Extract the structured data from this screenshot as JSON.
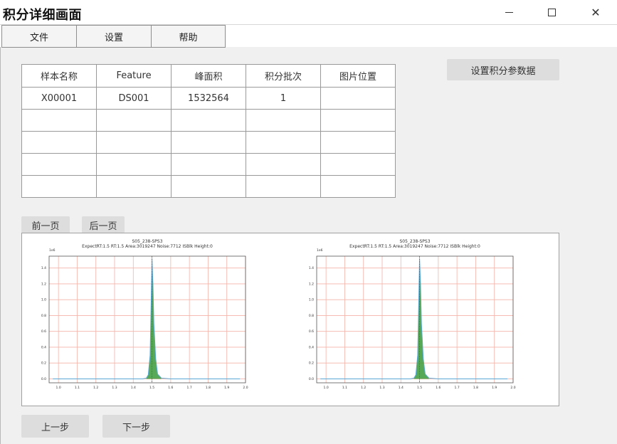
{
  "window": {
    "title": "积分详细画面",
    "controls": {
      "minimize": "minimize",
      "maximize": "maximize",
      "close": "✕"
    }
  },
  "menu": {
    "items": [
      "文件",
      "设置",
      "帮助"
    ]
  },
  "table": {
    "headers": [
      "样本名称",
      "Feature",
      "峰面积",
      "积分批次",
      "图片位置"
    ],
    "rows": [
      [
        "X00001",
        "DS001",
        "1532564",
        "1",
        ""
      ],
      [
        "",
        "",
        "",
        "",
        ""
      ],
      [
        "",
        "",
        "",
        "",
        ""
      ],
      [
        "",
        "",
        "",
        "",
        ""
      ],
      [
        "",
        "",
        "",
        "",
        ""
      ]
    ]
  },
  "buttons": {
    "set_params": "设置积分参数据",
    "prev_page": "前一页",
    "next_page": "后一页",
    "prev_step": "上一步",
    "next_step": "下一步"
  },
  "colors": {
    "grid": "#f4b3a8",
    "baseline": "#5aa7d6",
    "peak_fill": "#3a9a3a",
    "rt_line": "#e03030",
    "button_bg": "#dddddd"
  },
  "chart_data": [
    {
      "type": "area",
      "title": "S05_238-SPS3",
      "subtitle": "ExpectRT:1.5  RT:1.5  Area:3019247  Noise:7712  ISBlk Height:0",
      "y_exponent_label": "1e6",
      "xlim": [
        0.95,
        2.0
      ],
      "ylim": [
        -0.05,
        1.55
      ],
      "x_ticks": [
        "1.0",
        "1.1",
        "1.2",
        "1.3",
        "1.4",
        "1.5",
        "1.6",
        "1.7",
        "1.8",
        "1.9",
        "2.0"
      ],
      "y_ticks": [
        "0.0",
        "0.2",
        "0.4",
        "0.6",
        "0.8",
        "1.0",
        "1.2",
        "1.4"
      ],
      "expected_rt": 1.5,
      "x": [
        0.97,
        1.45,
        1.47,
        1.48,
        1.49,
        1.495,
        1.5,
        1.505,
        1.51,
        1.52,
        1.53,
        1.55,
        1.6,
        1.97
      ],
      "y": [
        0.0,
        0.0,
        0.01,
        0.05,
        0.3,
        0.9,
        1.52,
        1.2,
        0.7,
        0.25,
        0.06,
        0.01,
        0.0,
        0.0
      ]
    },
    {
      "type": "area",
      "title": "S05_238-SPS3",
      "subtitle": "ExpectRT:1.5  RT:1.5  Area:3019247  Noise:7712  ISBlk Height:0",
      "y_exponent_label": "1e6",
      "xlim": [
        0.95,
        2.0
      ],
      "ylim": [
        -0.05,
        1.55
      ],
      "x_ticks": [
        "1.0",
        "1.1",
        "1.2",
        "1.3",
        "1.4",
        "1.5",
        "1.6",
        "1.7",
        "1.8",
        "1.9",
        "2.0"
      ],
      "y_ticks": [
        "0.0",
        "0.2",
        "0.4",
        "0.6",
        "0.8",
        "1.0",
        "1.2",
        "1.4"
      ],
      "expected_rt": 1.5,
      "x": [
        0.97,
        1.45,
        1.47,
        1.48,
        1.49,
        1.495,
        1.5,
        1.505,
        1.51,
        1.52,
        1.53,
        1.55,
        1.6,
        1.97
      ],
      "y": [
        0.0,
        0.0,
        0.01,
        0.05,
        0.3,
        0.9,
        1.52,
        1.2,
        0.7,
        0.25,
        0.06,
        0.01,
        0.0,
        0.0
      ]
    }
  ]
}
